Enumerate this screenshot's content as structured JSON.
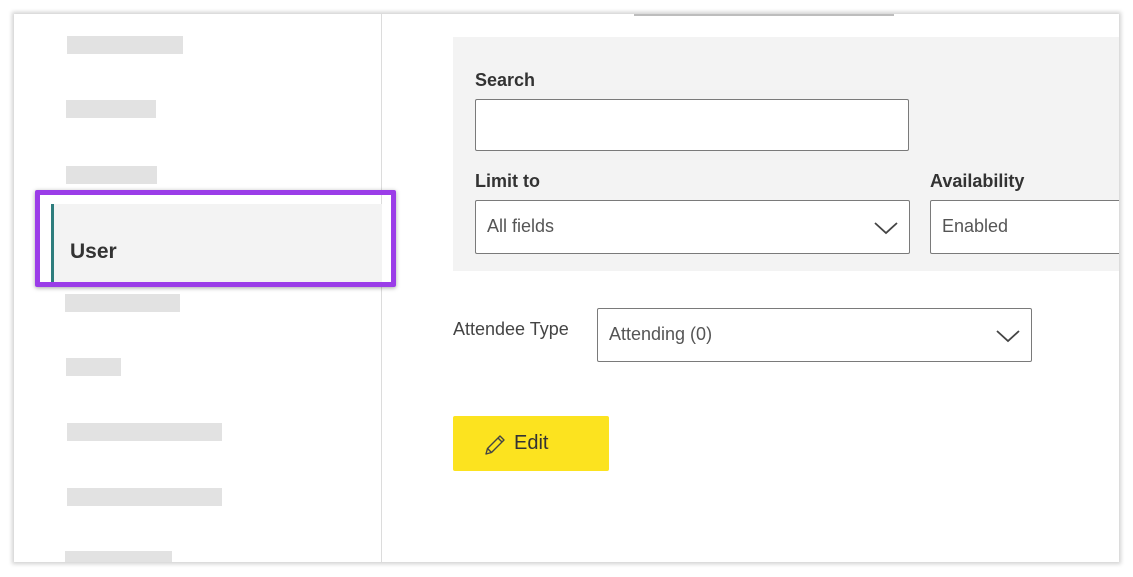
{
  "sidebar": {
    "active_item": "User"
  },
  "filters": {
    "search_label": "Search",
    "search_value": "",
    "limit_to_label": "Limit to",
    "limit_to_value": "All fields",
    "availability_label": "Availability",
    "availability_value": "Enabled"
  },
  "attendee": {
    "label": "Attendee Type",
    "value": "Attending (0)"
  },
  "actions": {
    "edit_label": "Edit"
  },
  "icons": {
    "dropdown": "chevron-down-icon",
    "edit": "pencil-icon"
  },
  "colors": {
    "highlight": "#9b3de8",
    "active_accent": "#2e7d7d",
    "edit_button": "#fce31f"
  }
}
